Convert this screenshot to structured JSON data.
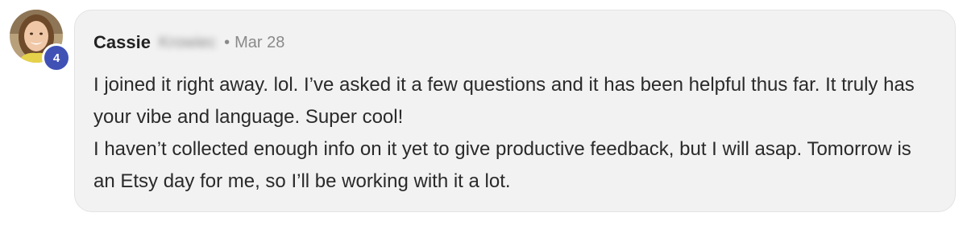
{
  "author": {
    "first_name": "Cassie",
    "last_name": "Krowiec",
    "level": "4"
  },
  "meta": {
    "separator": "•",
    "date": "Mar 28"
  },
  "comment": {
    "paragraphs": [
      "I joined it right away. lol. I’ve asked it a few questions and it has been helpful thus far. It truly has your vibe and language. Super cool!",
      "I haven’t collected enough info on it yet to give productive feedback, but I will asap. Tomorrow is an Etsy day for me, so I’ll be working with it a lot."
    ]
  },
  "colors": {
    "bubble_bg": "#f2f2f2",
    "badge": "#3f51b5",
    "meta_text": "#8a8a8a"
  }
}
